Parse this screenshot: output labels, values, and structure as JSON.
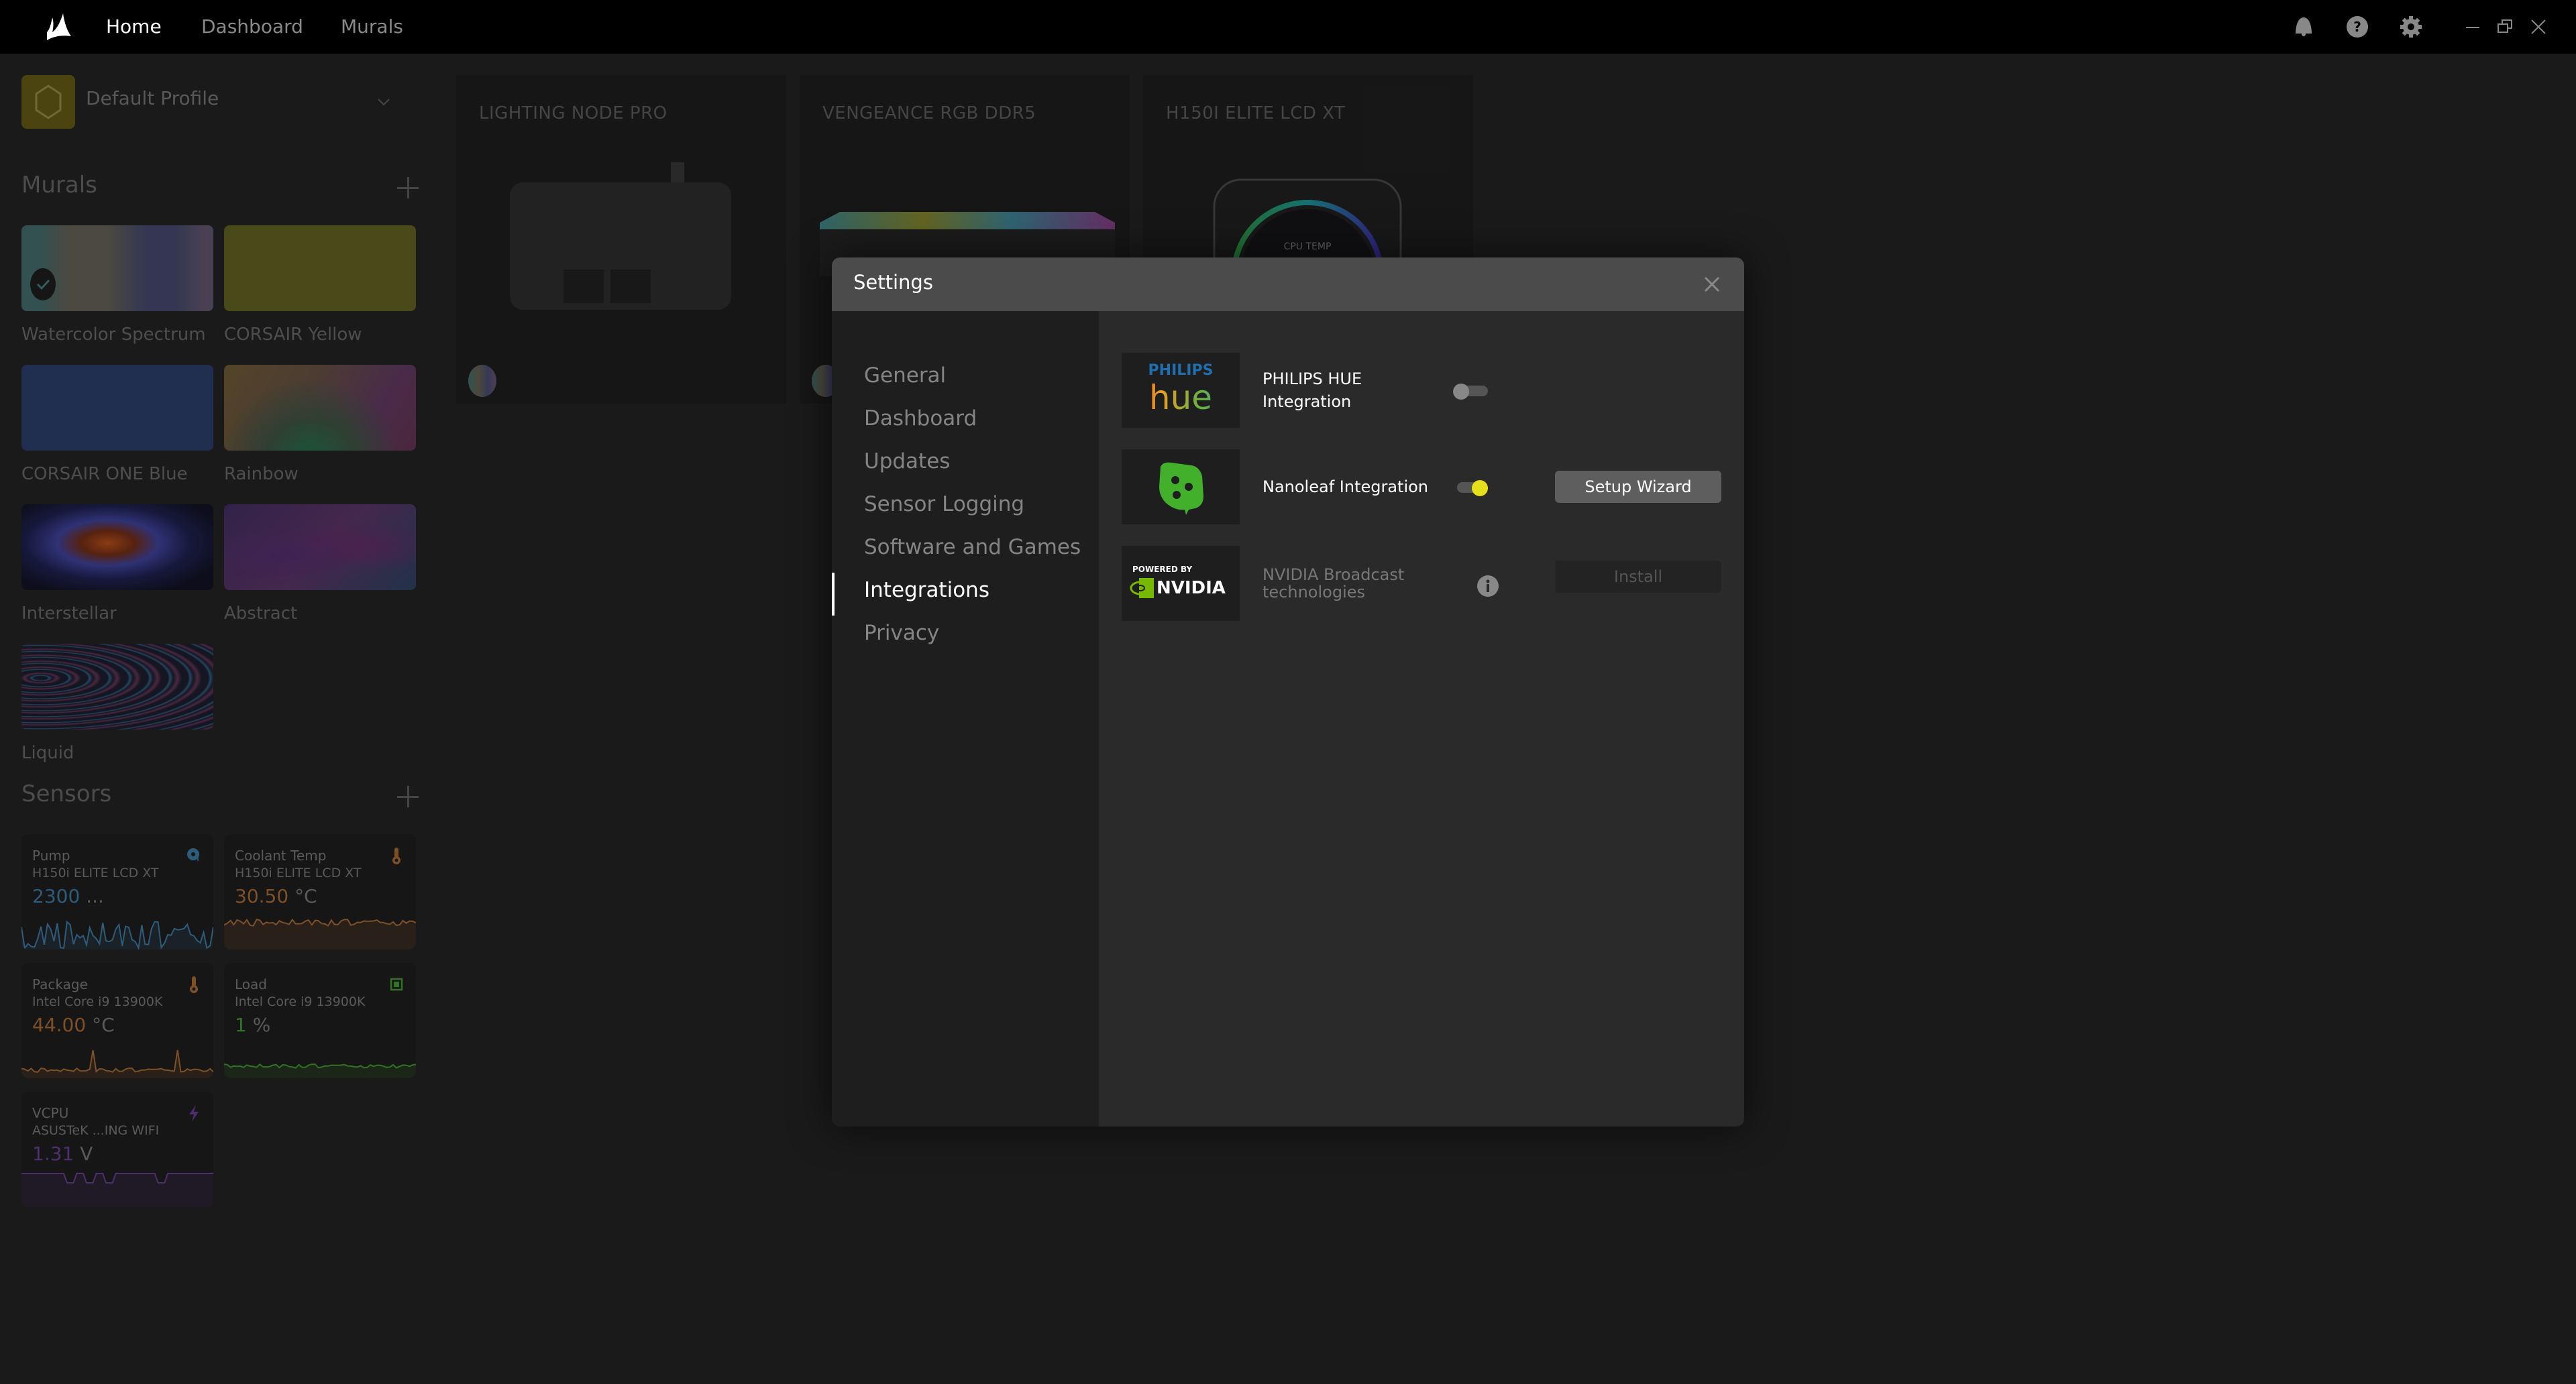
{
  "topbar": {
    "tabs": [
      {
        "label": "Home",
        "active": true
      },
      {
        "label": "Dashboard",
        "active": false
      },
      {
        "label": "Murals",
        "active": false
      }
    ],
    "icons": [
      "bell-icon",
      "help-icon",
      "gear-icon"
    ],
    "window_controls": [
      "minimize",
      "restore",
      "close"
    ]
  },
  "sidebar": {
    "profile": {
      "name": "Default Profile",
      "badge_color": "#5c5315"
    },
    "murals": {
      "title": "Murals",
      "items": [
        {
          "label": "Watercolor Spectrum",
          "selected": true
        },
        {
          "label": "CORSAIR Yellow",
          "selected": false
        },
        {
          "label": "CORSAIR ONE Blue",
          "selected": false
        },
        {
          "label": "Rainbow",
          "selected": false
        },
        {
          "label": "Interstellar",
          "selected": false
        },
        {
          "label": "Abstract",
          "selected": false
        },
        {
          "label": "Liquid",
          "selected": false
        }
      ]
    },
    "sensors": {
      "title": "Sensors",
      "items": [
        {
          "name": "Pump",
          "device": "H150i ELITE LCD XT",
          "value": "2300",
          "unit": "...",
          "color": "#3a6f95",
          "icon": "pump-icon"
        },
        {
          "name": "Coolant Temp",
          "device": "H150i ELITE LCD XT",
          "value": "30.50",
          "unit": "°C",
          "color": "#9a6230",
          "icon": "thermometer-icon"
        },
        {
          "name": "Package",
          "device": "Intel Core i9 13900K",
          "value": "44.00",
          "unit": "°C",
          "color": "#9a6230",
          "icon": "thermometer-icon"
        },
        {
          "name": "Load",
          "device": "Intel Core i9 13900K",
          "value": "1",
          "unit": "%",
          "color": "#3f8a2e",
          "icon": "cpu-icon"
        },
        {
          "name": "VCPU",
          "device": "ASUSTeK ...ING WIFI",
          "value": "1.31",
          "unit": "V",
          "color": "#5e3a85",
          "icon": "lightning-icon"
        }
      ]
    }
  },
  "devices": [
    {
      "title": "LIGHTING NODE PRO"
    },
    {
      "title": "VENGEANCE RGB DDR5"
    },
    {
      "title": "H150I ELITE LCD XT",
      "screen_label": "CPU TEMP"
    }
  ],
  "settings_modal": {
    "title": "Settings",
    "nav": [
      {
        "label": "General",
        "active": false
      },
      {
        "label": "Dashboard",
        "active": false
      },
      {
        "label": "Updates",
        "active": false
      },
      {
        "label": "Sensor Logging",
        "active": false
      },
      {
        "label": "Software and Games",
        "active": false
      },
      {
        "label": "Integrations",
        "active": true
      },
      {
        "label": "Privacy",
        "active": false
      }
    ],
    "integrations": [
      {
        "logo_top": "PHILIPS",
        "logo_bottom": "hue",
        "label_line1": "PHILIPS HUE",
        "label_line2": "Integration",
        "enabled": false
      },
      {
        "label": "Nanoleaf Integration",
        "enabled": true,
        "button": "Setup Wizard"
      },
      {
        "logo_top": "POWERED BY",
        "logo_bottom": "NVIDIA",
        "label_line1": "NVIDIA Broadcast",
        "label_line2": "technologies",
        "button": "Install",
        "button_disabled": true
      }
    ],
    "accent_color": "#e6e01a"
  }
}
